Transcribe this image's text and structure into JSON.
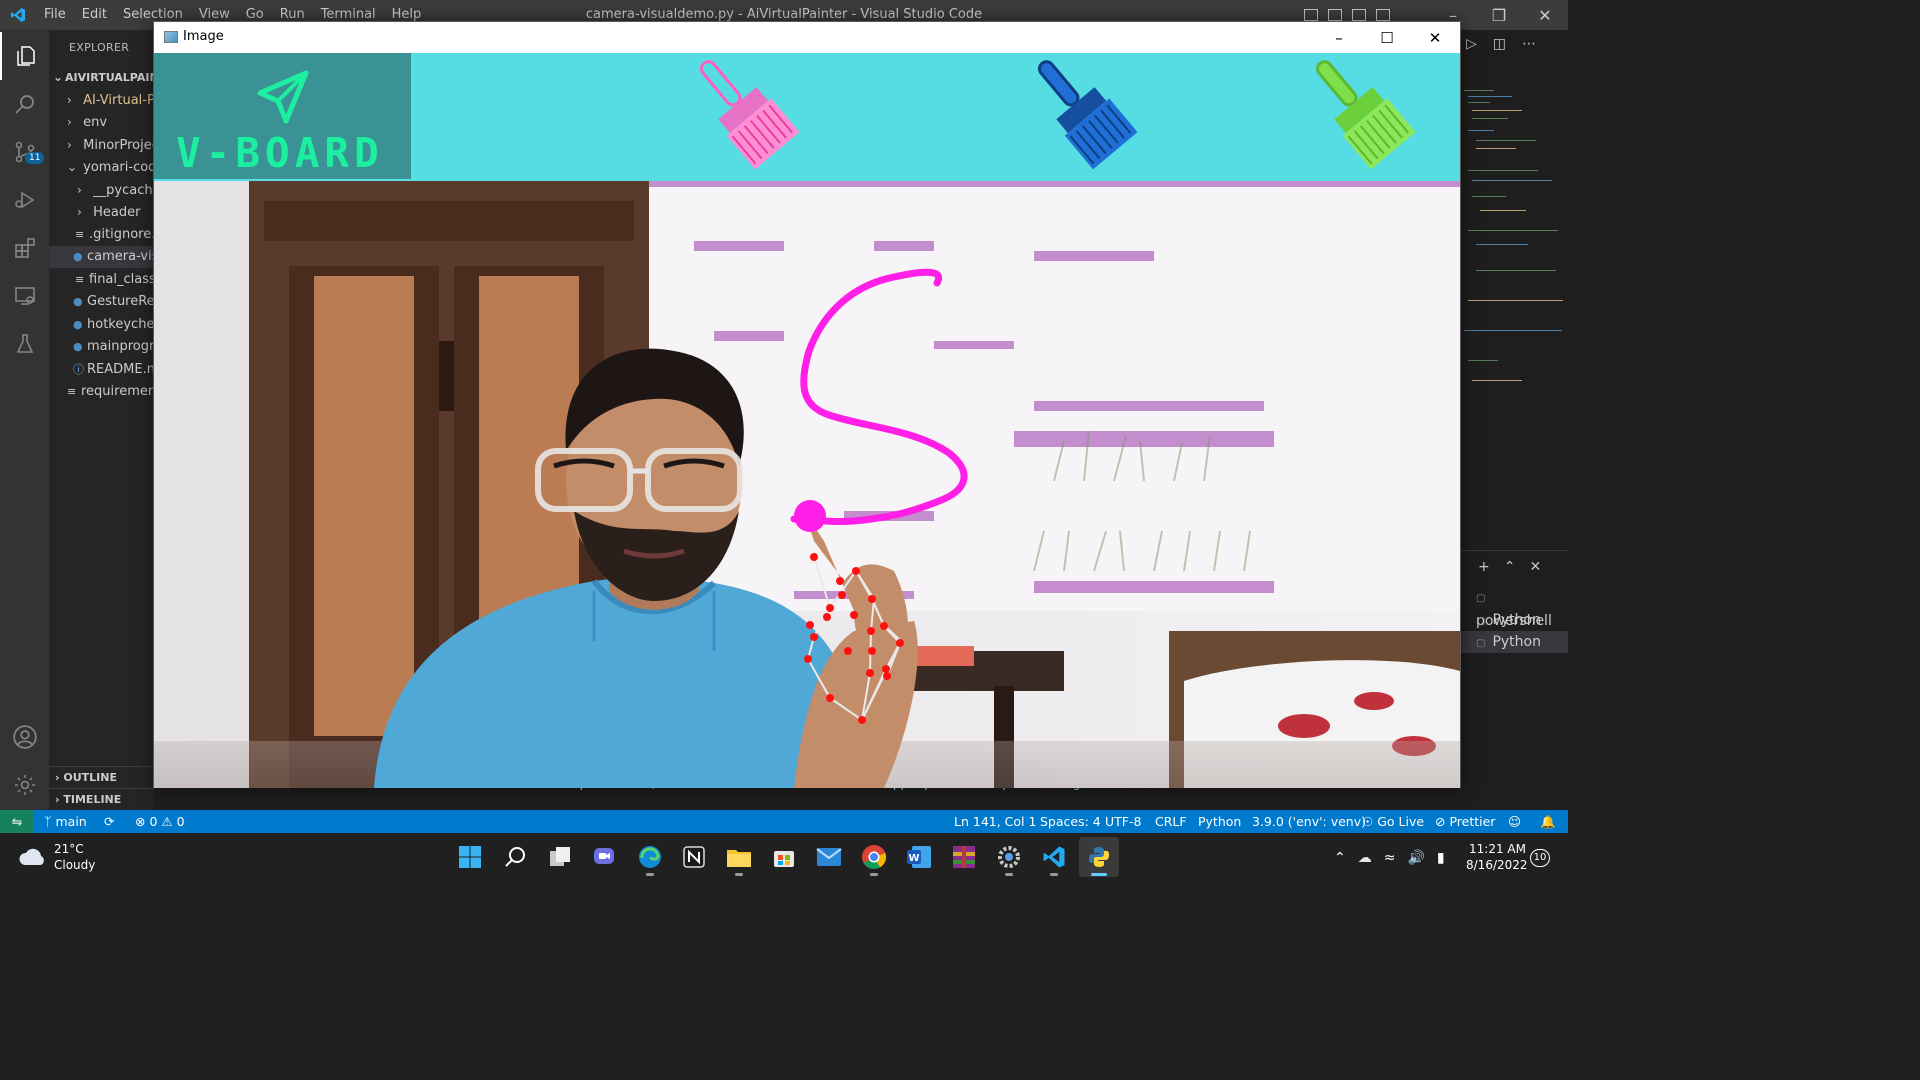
{
  "vscode": {
    "menu": [
      "File",
      "Edit",
      "Selection",
      "View",
      "Go",
      "Run",
      "Terminal",
      "Help"
    ],
    "window_title": "camera-visualdemo.py - AiVirtualPainter - Visual Studio Code",
    "activity_badge": "11",
    "explorer_title": "EXPLORER",
    "root_folder": "AIVIRTUALPAIN",
    "tree": [
      {
        "label": "AI-Virtual-Pa",
        "kind": "folder"
      },
      {
        "label": "env",
        "kind": "folder"
      },
      {
        "label": "MinorProjec",
        "kind": "folder"
      },
      {
        "label": "yomari-code",
        "kind": "folder-open"
      },
      {
        "label": "__pycache_",
        "kind": "folder"
      },
      {
        "label": "Header",
        "kind": "folder"
      },
      {
        "label": ".gitignore.t",
        "kind": "file"
      },
      {
        "label": "camera-vis",
        "kind": "python"
      },
      {
        "label": "final_classi",
        "kind": "file"
      },
      {
        "label": "GestureRe",
        "kind": "python"
      },
      {
        "label": "hotkeyche",
        "kind": "python"
      },
      {
        "label": "mainprogr",
        "kind": "python"
      },
      {
        "label": "README.n",
        "kind": "info"
      },
      {
        "label": "requirement",
        "kind": "file"
      }
    ],
    "outline_label": "OUTLINE",
    "timeline_label": "TIMELINE",
    "editor_line": "To enable them in other operations, rebuild TensorFlow with the appropriate compiler flags.",
    "terminals": [
      "powershell",
      "Python",
      "Python"
    ],
    "status": {
      "branch": "main",
      "problems_errors": "0",
      "problems_warnings": "0",
      "cursor": "Ln 141, Col 1",
      "spaces": "Spaces: 4",
      "encoding": "UTF-8",
      "eol": "CRLF",
      "language": "Python",
      "interpreter": "3.9.0 ('env': venv)",
      "golive": "Go Live",
      "prettier": "Prettier"
    }
  },
  "image_window": {
    "title": "Image",
    "logo_text": "V-BOARD",
    "brush_colors": [
      "#ff5fbf",
      "#1f6fd6",
      "#7ee04a"
    ],
    "stroke_color": "#ff1fe6",
    "landmark_color": "#ff1010"
  },
  "taskbar": {
    "weather_temp": "21°C",
    "weather_desc": "Cloudy",
    "time": "11:21 AM",
    "date": "8/16/2022",
    "notifications": "10",
    "apps": [
      "start-icon",
      "search-icon",
      "task-view-icon",
      "teams-chat-icon",
      "edge-icon",
      "notion-icon",
      "file-explorer-icon",
      "store-icon",
      "mail-icon",
      "chrome-icon",
      "word-icon",
      "winrar-icon",
      "settings-icon",
      "vscode-icon",
      "python-icon"
    ]
  },
  "colors": {
    "statusbar": "#007acc",
    "header": "#56dde3",
    "logo_bg": "#3a9294",
    "logo_text": "#1cf0a0"
  }
}
